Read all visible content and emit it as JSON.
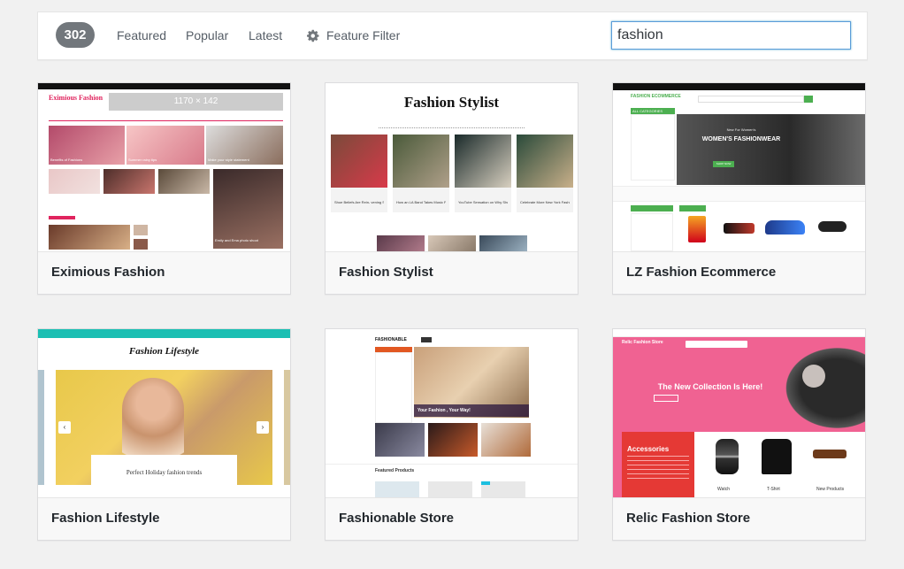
{
  "filter": {
    "count": "302",
    "links": [
      "Featured",
      "Popular",
      "Latest"
    ],
    "feature_filter": "Feature Filter",
    "search_value": "fashion"
  },
  "themes": [
    {
      "name": "Eximious Fashion",
      "logo": "Eximious Fashion",
      "banner": "1170 × 142",
      "captions": [
        "Benefits of Fashions",
        "Summer rainy tips",
        "Make your style statement",
        "Emily and Ema photo shoot"
      ]
    },
    {
      "name": "Fashion Stylist",
      "logo": "Fashion Stylist",
      "captions": [
        "Shoe Beliefs Are Rein- vening Style",
        "How an LA Band Takes Music Festival",
        "YouTube Sensation on Why She's Loved",
        "Celebrate More New York Fashion"
      ]
    },
    {
      "name": "LZ Fashion Ecommerce",
      "logo": "FASHION ECOMMERCE",
      "menu_title": "ALL CATEGORIES",
      "hero_small": "New For Women's",
      "hero_title": "WOMEN'S FASHIONWEAR",
      "hero_button": "SHOP NOW"
    },
    {
      "name": "Fashion Lifestyle",
      "logo": "Fashion Lifestyle",
      "slide_caption": "Perfect Holiday fashion trends"
    },
    {
      "name": "Fashionable Store",
      "logo": "FASHIONABLE",
      "hero_caption": "Your Fashion , Your Way!",
      "section_title": "Featured Products"
    },
    {
      "name": "Relic Fashion Store",
      "logo": "Relic Fashion Store",
      "hero_title": "The New Collection Is Here!",
      "promo_title": "Accessories",
      "products": [
        "Watch",
        "T-Shirt",
        "New Products"
      ]
    }
  ],
  "colors": {
    "count_badge": "#72777c",
    "link": "#555d66",
    "search_focus": "#5b9dd9",
    "relic_pink": "#f06292",
    "lz_green": "#4caf50",
    "lifestyle_teal": "#1bbfb3"
  }
}
